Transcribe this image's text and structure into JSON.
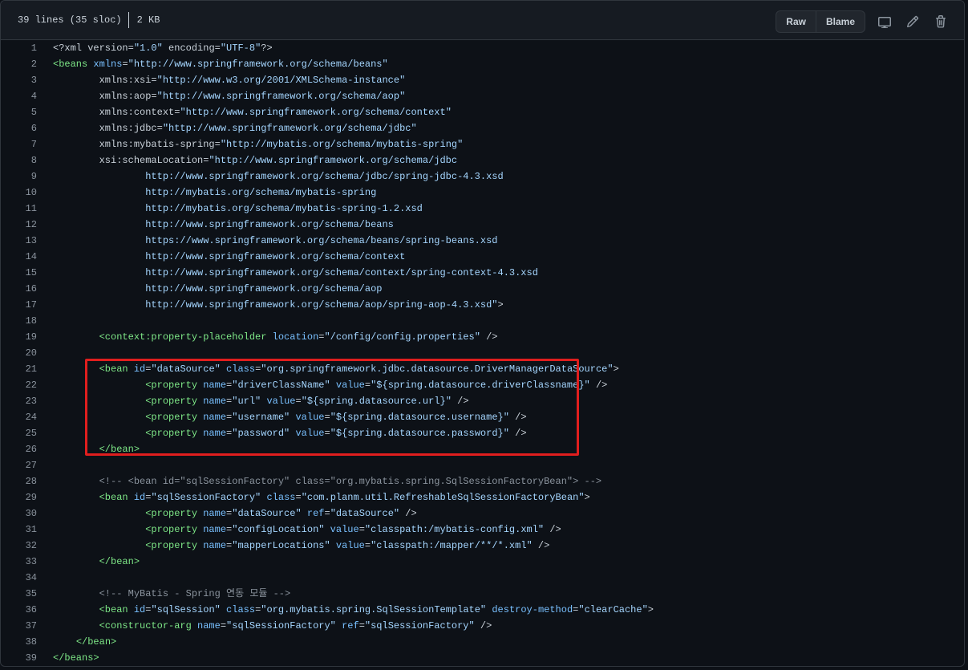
{
  "file_header": {
    "lines_info": "39 lines (35 sloc)",
    "size": "2 KB",
    "raw_label": "Raw",
    "blame_label": "Blame",
    "icons": [
      "desktop-icon",
      "pencil-icon",
      "trash-icon"
    ]
  },
  "colors": {
    "background": "#0d1117",
    "tag": "#7ee787",
    "attribute": "#79c0ff",
    "string": "#a5d6ff",
    "comment": "#8b949e",
    "highlight": "#e01e1e"
  },
  "code_lines": [
    {
      "n": "1",
      "t": [
        [
          "x",
          "<?xml version="
        ],
        [
          "s",
          "\"1.0\""
        ],
        [
          "x",
          " encoding="
        ],
        [
          "s",
          "\"UTF-8\""
        ],
        [
          "x",
          "?>"
        ]
      ]
    },
    {
      "n": "2",
      "t": [
        [
          "g",
          "<beans"
        ],
        [
          "a",
          " xmlns"
        ],
        [
          "x",
          "="
        ],
        [
          "s",
          "\"http://www.springframework.org/schema/beans\""
        ]
      ]
    },
    {
      "n": "3",
      "t": [
        [
          "x",
          "        xmlns:xsi="
        ],
        [
          "s",
          "\"http://www.w3.org/2001/XMLSchema-instance\""
        ]
      ]
    },
    {
      "n": "4",
      "t": [
        [
          "x",
          "        xmlns:aop="
        ],
        [
          "s",
          "\"http://www.springframework.org/schema/aop\""
        ]
      ]
    },
    {
      "n": "5",
      "t": [
        [
          "x",
          "        xmlns:context="
        ],
        [
          "s",
          "\"http://www.springframework.org/schema/context\""
        ]
      ]
    },
    {
      "n": "6",
      "t": [
        [
          "x",
          "        xmlns:jdbc="
        ],
        [
          "s",
          "\"http://www.springframework.org/schema/jdbc\""
        ]
      ]
    },
    {
      "n": "7",
      "t": [
        [
          "x",
          "        xmlns:mybatis-spring="
        ],
        [
          "s",
          "\"http://mybatis.org/schema/mybatis-spring\""
        ]
      ]
    },
    {
      "n": "8",
      "t": [
        [
          "x",
          "        xsi:schemaLocation="
        ],
        [
          "s",
          "\"http://www.springframework.org/schema/jdbc"
        ]
      ]
    },
    {
      "n": "9",
      "t": [
        [
          "s",
          "                http://www.springframework.org/schema/jdbc/spring-jdbc-4.3.xsd"
        ]
      ]
    },
    {
      "n": "10",
      "t": [
        [
          "s",
          "                http://mybatis.org/schema/mybatis-spring"
        ]
      ]
    },
    {
      "n": "11",
      "t": [
        [
          "s",
          "                http://mybatis.org/schema/mybatis-spring-1.2.xsd"
        ]
      ]
    },
    {
      "n": "12",
      "t": [
        [
          "s",
          "                http://www.springframework.org/schema/beans"
        ]
      ]
    },
    {
      "n": "13",
      "t": [
        [
          "s",
          "                https://www.springframework.org/schema/beans/spring-beans.xsd"
        ]
      ]
    },
    {
      "n": "14",
      "t": [
        [
          "s",
          "                http://www.springframework.org/schema/context"
        ]
      ]
    },
    {
      "n": "15",
      "t": [
        [
          "s",
          "                http://www.springframework.org/schema/context/spring-context-4.3.xsd"
        ]
      ]
    },
    {
      "n": "16",
      "t": [
        [
          "s",
          "                http://www.springframework.org/schema/aop"
        ]
      ]
    },
    {
      "n": "17",
      "t": [
        [
          "s",
          "                http://www.springframework.org/schema/aop/spring-aop-4.3.xsd\""
        ],
        [
          "x",
          ">"
        ]
      ]
    },
    {
      "n": "18",
      "t": []
    },
    {
      "n": "19",
      "t": [
        [
          "x",
          "        "
        ],
        [
          "g",
          "<context:property-placeholder"
        ],
        [
          "a",
          " location"
        ],
        [
          "x",
          "="
        ],
        [
          "s",
          "\"/config/config.properties\""
        ],
        [
          "x",
          " />"
        ]
      ]
    },
    {
      "n": "20",
      "t": []
    },
    {
      "n": "21",
      "t": [
        [
          "x",
          "        "
        ],
        [
          "g",
          "<bean"
        ],
        [
          "a",
          " id"
        ],
        [
          "x",
          "="
        ],
        [
          "s",
          "\"dataSource\""
        ],
        [
          "a",
          " class"
        ],
        [
          "x",
          "="
        ],
        [
          "s",
          "\"org.springframework.jdbc.datasource.DriverManagerDataSource\""
        ],
        [
          "x",
          ">"
        ]
      ]
    },
    {
      "n": "22",
      "t": [
        [
          "x",
          "                "
        ],
        [
          "g",
          "<property"
        ],
        [
          "a",
          " name"
        ],
        [
          "x",
          "="
        ],
        [
          "s",
          "\"driverClassName\""
        ],
        [
          "a",
          " value"
        ],
        [
          "x",
          "="
        ],
        [
          "s",
          "\"${spring.datasource.driverClassname}\""
        ],
        [
          "x",
          " />"
        ]
      ]
    },
    {
      "n": "23",
      "t": [
        [
          "x",
          "                "
        ],
        [
          "g",
          "<property"
        ],
        [
          "a",
          " name"
        ],
        [
          "x",
          "="
        ],
        [
          "s",
          "\"url\""
        ],
        [
          "a",
          " value"
        ],
        [
          "x",
          "="
        ],
        [
          "s",
          "\"${spring.datasource.url}\""
        ],
        [
          "x",
          " />"
        ]
      ]
    },
    {
      "n": "24",
      "t": [
        [
          "x",
          "                "
        ],
        [
          "g",
          "<property"
        ],
        [
          "a",
          " name"
        ],
        [
          "x",
          "="
        ],
        [
          "s",
          "\"username\""
        ],
        [
          "a",
          " value"
        ],
        [
          "x",
          "="
        ],
        [
          "s",
          "\"${spring.datasource.username}\""
        ],
        [
          "x",
          " />"
        ]
      ]
    },
    {
      "n": "25",
      "t": [
        [
          "x",
          "                "
        ],
        [
          "g",
          "<property"
        ],
        [
          "a",
          " name"
        ],
        [
          "x",
          "="
        ],
        [
          "s",
          "\"password\""
        ],
        [
          "a",
          " value"
        ],
        [
          "x",
          "="
        ],
        [
          "s",
          "\"${spring.datasource.password}\""
        ],
        [
          "x",
          " />"
        ]
      ]
    },
    {
      "n": "26",
      "t": [
        [
          "x",
          "        "
        ],
        [
          "g",
          "</bean>"
        ]
      ]
    },
    {
      "n": "27",
      "t": []
    },
    {
      "n": "28",
      "t": [
        [
          "c",
          "        <!-- <bean id=\"sqlSessionFactory\" class=\"org.mybatis.spring.SqlSessionFactoryBean\"> -->"
        ]
      ]
    },
    {
      "n": "29",
      "t": [
        [
          "x",
          "        "
        ],
        [
          "g",
          "<bean"
        ],
        [
          "a",
          " id"
        ],
        [
          "x",
          "="
        ],
        [
          "s",
          "\"sqlSessionFactory\""
        ],
        [
          "a",
          " class"
        ],
        [
          "x",
          "="
        ],
        [
          "s",
          "\"com.planm.util.RefreshableSqlSessionFactoryBean\""
        ],
        [
          "x",
          ">"
        ]
      ]
    },
    {
      "n": "30",
      "t": [
        [
          "x",
          "                "
        ],
        [
          "g",
          "<property"
        ],
        [
          "a",
          " name"
        ],
        [
          "x",
          "="
        ],
        [
          "s",
          "\"dataSource\""
        ],
        [
          "a",
          " ref"
        ],
        [
          "x",
          "="
        ],
        [
          "s",
          "\"dataSource\""
        ],
        [
          "x",
          " />"
        ]
      ]
    },
    {
      "n": "31",
      "t": [
        [
          "x",
          "                "
        ],
        [
          "g",
          "<property"
        ],
        [
          "a",
          " name"
        ],
        [
          "x",
          "="
        ],
        [
          "s",
          "\"configLocation\""
        ],
        [
          "a",
          " value"
        ],
        [
          "x",
          "="
        ],
        [
          "s",
          "\"classpath:/mybatis-config.xml\""
        ],
        [
          "x",
          " />"
        ]
      ]
    },
    {
      "n": "32",
      "t": [
        [
          "x",
          "                "
        ],
        [
          "g",
          "<property"
        ],
        [
          "a",
          " name"
        ],
        [
          "x",
          "="
        ],
        [
          "s",
          "\"mapperLocations\""
        ],
        [
          "a",
          " value"
        ],
        [
          "x",
          "="
        ],
        [
          "s",
          "\"classpath:/mapper/**/*.xml\""
        ],
        [
          "x",
          " />"
        ]
      ]
    },
    {
      "n": "33",
      "t": [
        [
          "x",
          "        "
        ],
        [
          "g",
          "</bean>"
        ]
      ]
    },
    {
      "n": "34",
      "t": []
    },
    {
      "n": "35",
      "t": [
        [
          "c",
          "        <!-- MyBatis - Spring 연동 모듈 -->"
        ]
      ]
    },
    {
      "n": "36",
      "t": [
        [
          "x",
          "        "
        ],
        [
          "g",
          "<bean"
        ],
        [
          "a",
          " id"
        ],
        [
          "x",
          "="
        ],
        [
          "s",
          "\"sqlSession\""
        ],
        [
          "a",
          " class"
        ],
        [
          "x",
          "="
        ],
        [
          "s",
          "\"org.mybatis.spring.SqlSessionTemplate\""
        ],
        [
          "a",
          " destroy-method"
        ],
        [
          "x",
          "="
        ],
        [
          "s",
          "\"clearCache\""
        ],
        [
          "x",
          ">"
        ]
      ]
    },
    {
      "n": "37",
      "t": [
        [
          "x",
          "        "
        ],
        [
          "g",
          "<constructor-arg"
        ],
        [
          "a",
          " name"
        ],
        [
          "x",
          "="
        ],
        [
          "s",
          "\"sqlSessionFactory\""
        ],
        [
          "a",
          " ref"
        ],
        [
          "x",
          "="
        ],
        [
          "s",
          "\"sqlSessionFactory\""
        ],
        [
          "x",
          " />"
        ]
      ]
    },
    {
      "n": "38",
      "t": [
        [
          "x",
          "    "
        ],
        [
          "g",
          "</bean>"
        ]
      ]
    },
    {
      "n": "39",
      "t": [
        [
          "g",
          "</beans>"
        ]
      ]
    }
  ]
}
